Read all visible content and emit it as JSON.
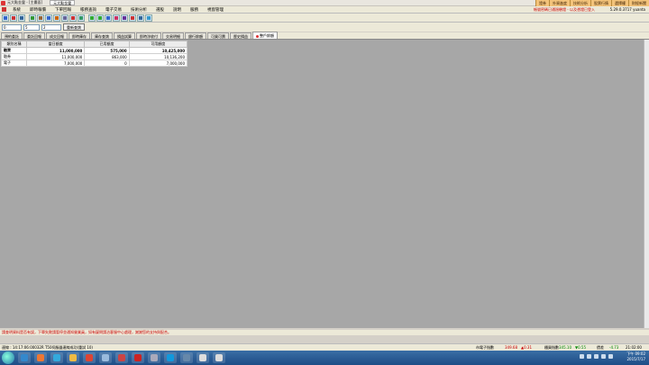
{
  "titlebar": {
    "app_title": "元大點金靈 - [主畫面]",
    "active_tab": "元大點金靈",
    "buttons": [
      "證券",
      "外資進度",
      "技術分析",
      "股票行情",
      "選擇權",
      "財經新聞"
    ]
  },
  "menubar": {
    "items": [
      "系統",
      "即時報價",
      "下單回報",
      "帳務查詢",
      "電子交易",
      "技術分析",
      "選股",
      "說明",
      "服務",
      "視窗管理"
    ],
    "status_text": "帳號密碼已通過驗證 - 以及憑證已登入",
    "version": "5.29.0.3717 yuanta"
  },
  "query": {
    "account": "0",
    "market": "5",
    "type": "2",
    "button_label": "重新查詢"
  },
  "tabs": [
    "預約委託",
    "委託回報",
    "成交回報",
    "即時庫存",
    "庫存查詢",
    "損益試算",
    "即時淨收付",
    "交易明細",
    "銀行餘額",
    "可買可賣",
    "歷史損益",
    "整戶餘額"
  ],
  "active_tab_index": 11,
  "grid": {
    "headers": [
      "類別名稱",
      "當日額度",
      "已用額度",
      "可用額度"
    ],
    "rows": [
      {
        "label": "融資",
        "col1": "11,000,000",
        "col2": "575,000",
        "col3": "10,425,000",
        "bold": true
      },
      {
        "label": "融券",
        "col1": "11,000,000",
        "col2": "863,000",
        "col3": "10,136,200",
        "bold": false
      },
      {
        "label": "電子",
        "col1": "7,000,000",
        "col2": "0",
        "col3": "7,000,000",
        "bold": false
      }
    ]
  },
  "message": "請查明資料是否有誤，下單失敗請暫停並通知營業員，如有疑問請洽客服中心處理，謝謝您的支持與配合。",
  "status": {
    "left": "連線 : 14:17:06:00032R T50伺服器連線成功(重試 10)",
    "index_label": "市電子指數",
    "index_value": "349.68",
    "index_change": "▲0.31",
    "otc_label": "櫃買指數",
    "otc_value": "345.10",
    "otc_change": "▼0.55",
    "diff_label": "價差",
    "diff_value": "-4.73",
    "time": "21:02:00"
  },
  "taskbar": {
    "clock_time": "下午 09:02",
    "clock_date": "2015/7/17"
  }
}
